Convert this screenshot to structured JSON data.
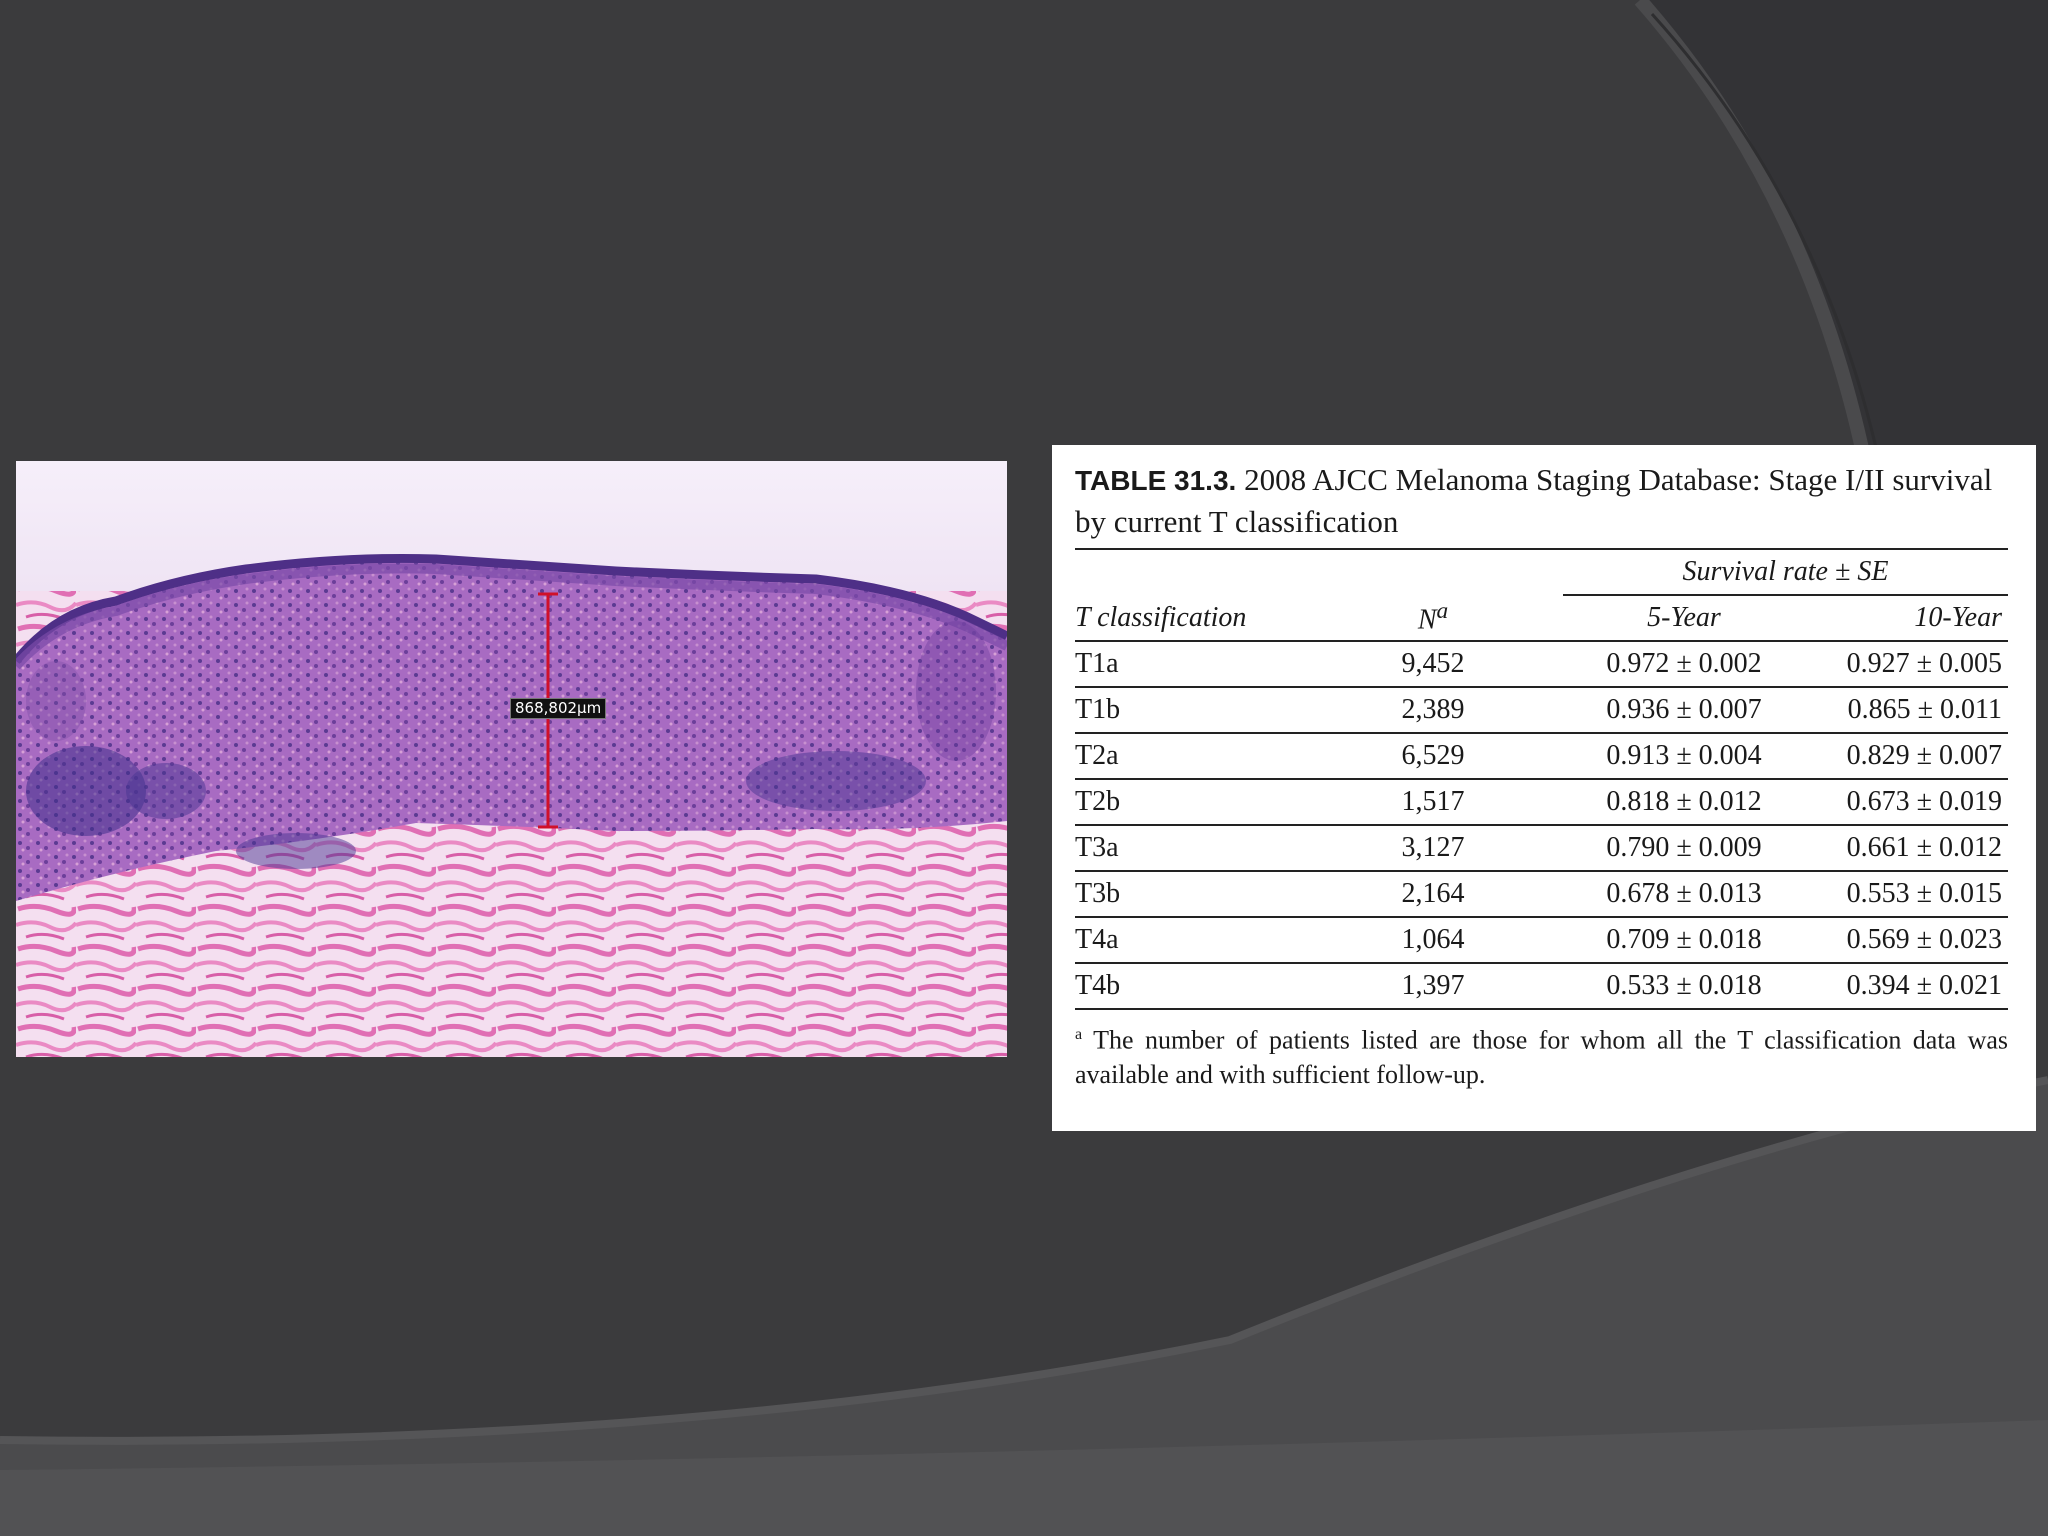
{
  "micrograph": {
    "measurement_label": "868,802µm"
  },
  "table": {
    "label": "TABLE 31.3.",
    "title": "2008 AJCC Melanoma Staging Database: Stage I/II survival by current T classification",
    "spanner": "Survival rate ± SE",
    "columns": {
      "t_class": "T classification",
      "n": "N",
      "n_marker": "a",
      "five_year": "5-Year",
      "ten_year": "10-Year"
    },
    "rows": [
      {
        "t": "T1a",
        "n": "9,452",
        "y5": "0.972 ± 0.002",
        "y10": "0.927 ± 0.005"
      },
      {
        "t": "T1b",
        "n": "2,389",
        "y5": "0.936 ± 0.007",
        "y10": "0.865 ± 0.011"
      },
      {
        "t": "T2a",
        "n": "6,529",
        "y5": "0.913 ± 0.004",
        "y10": "0.829 ± 0.007"
      },
      {
        "t": "T2b",
        "n": "1,517",
        "y5": "0.818 ± 0.012",
        "y10": "0.673 ± 0.019"
      },
      {
        "t": "T3a",
        "n": "3,127",
        "y5": "0.790 ± 0.009",
        "y10": "0.661 ± 0.012"
      },
      {
        "t": "T3b",
        "n": "2,164",
        "y5": "0.678 ± 0.013",
        "y10": "0.553 ± 0.015"
      },
      {
        "t": "T4a",
        "n": "1,064",
        "y5": "0.709 ± 0.018",
        "y10": "0.569 ± 0.023"
      },
      {
        "t": "T4b",
        "n": "1,397",
        "y5": "0.533 ± 0.018",
        "y10": "0.394 ± 0.021"
      }
    ],
    "footnote_marker": "a",
    "footnote": "The number of patients listed are those for whom all the T classification data was available and with sufficient follow-up."
  },
  "colors": {
    "slide_background": "#3b3b3d",
    "measure_line": "#d0102a",
    "stain_epidermis": "#7a3f9e",
    "stain_dermis": "#e48bc6"
  }
}
